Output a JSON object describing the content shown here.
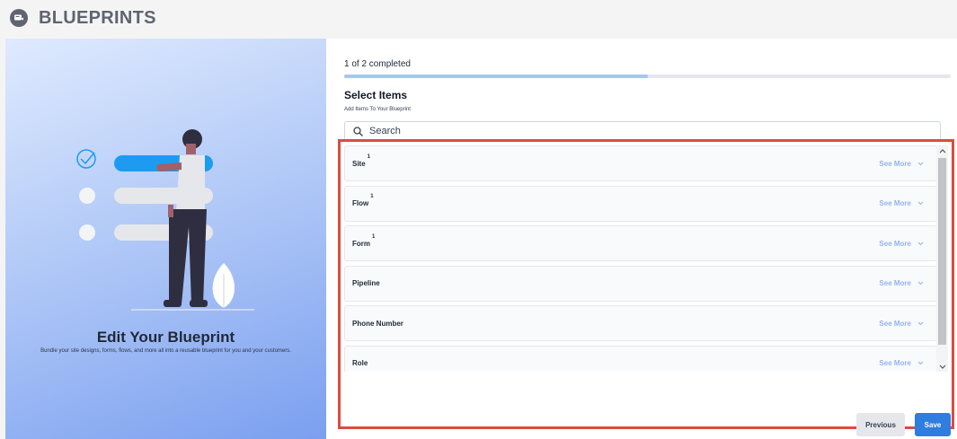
{
  "app": {
    "title": "BLUEPRINTS",
    "logo_icon": "blueprint-logo-icon"
  },
  "hero": {
    "title": "Edit Your Blueprint",
    "subtitle": "Bundle your site designs, forms, flows, and more all into a reusable blueprint for you and your customers."
  },
  "progress": {
    "text": "1 of 2 completed",
    "completed": 1,
    "total": 2,
    "fraction": 0.5
  },
  "section": {
    "title": "Select Items",
    "subtitle": "Add Items To Your Blueprint"
  },
  "search": {
    "placeholder": "Search",
    "value": "",
    "icon": "search-icon"
  },
  "items": [
    {
      "label": "Site",
      "count": "1",
      "action": "See More"
    },
    {
      "label": "Flow",
      "count": "1",
      "action": "See More"
    },
    {
      "label": "Form",
      "count": "1",
      "action": "See More"
    },
    {
      "label": "Pipeline",
      "count": "",
      "action": "See More"
    },
    {
      "label": "Phone Number",
      "count": "",
      "action": "See More"
    },
    {
      "label": "Role",
      "count": "",
      "action": "See More"
    }
  ],
  "buttons": {
    "previous": "Previous",
    "save": "Save"
  },
  "colors": {
    "accent": "#2f7de1",
    "highlight_border": "#dc4c3f",
    "progress": "#a8c6f3",
    "hero_bottom": "#7b9ff0"
  }
}
